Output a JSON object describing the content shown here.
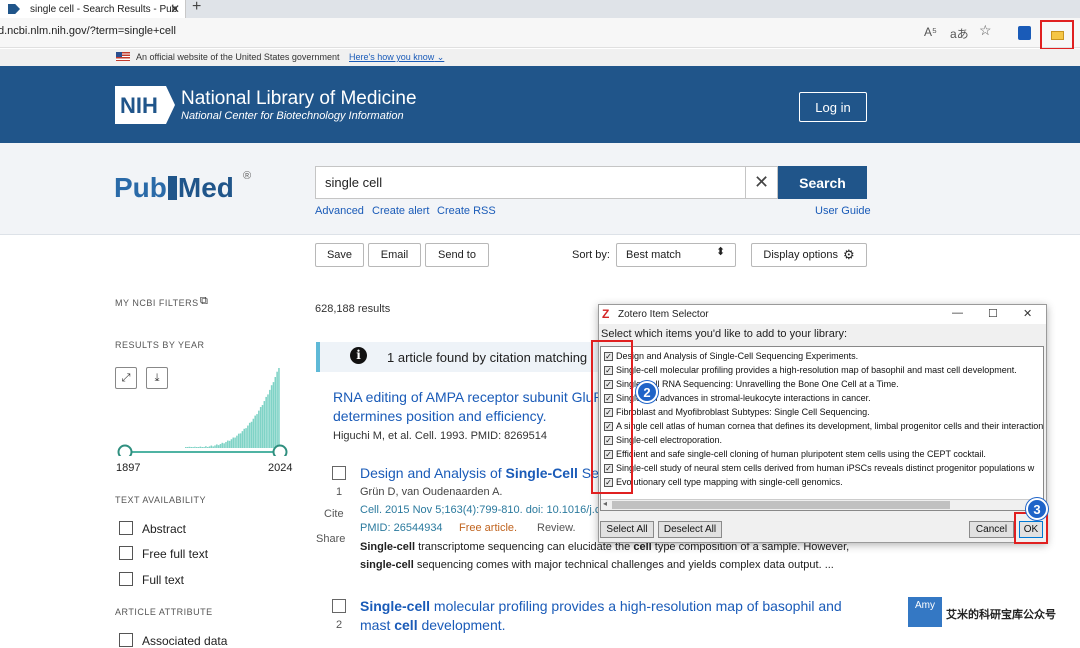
{
  "browser": {
    "tab_title": "single cell - Search Results - Pub",
    "tab_close": "✕",
    "new_tab": "+",
    "url": "d.ncbi.nlm.nih.gov/?term=single+cell",
    "icons": [
      "read-aloud-icon",
      "translate-icon",
      "favorite-icon",
      "bitwarden-icon",
      "zotero-save-icon"
    ],
    "read_aloud": "A⁵",
    "translate": "aあ",
    "favorite": "☆",
    "bitwarden": "⛉"
  },
  "gov_banner": {
    "text": "An official website of the United States government",
    "link": "Here's how you know"
  },
  "nih": {
    "logo": "NIH",
    "title": "National Library of Medicine",
    "subtitle": "National Center for Biotechnology Information",
    "login": "Log in"
  },
  "search": {
    "logo_pub": "Pub",
    "logo_med": "Med",
    "registered": "®",
    "value": "single cell",
    "clear": "✕",
    "button": "Search",
    "links": [
      "Advanced",
      "Create alert",
      "Create RSS"
    ],
    "user_guide": "User Guide"
  },
  "toolbar": {
    "save": "Save",
    "email": "Email",
    "send_to": "Send to",
    "sort_label": "Sort by:",
    "sort_value": "Best match",
    "display_options": "Display options"
  },
  "sidebar": {
    "my_filters": "MY NCBI FILTERS",
    "results_by_year": "RESULTS BY YEAR",
    "year_start": "1897",
    "year_end": "2024",
    "text_availability": "TEXT AVAILABILITY",
    "filters": [
      "Abstract",
      "Free full text",
      "Full text"
    ],
    "article_attribute": "ARTICLE ATTRIBUTE",
    "attribute_item": "Associated data"
  },
  "results": {
    "count": "628,188 results",
    "citation_note": "1 article found by citation matching",
    "cited": {
      "title_l1": "RNA editing of AMPA receptor subunit GluR",
      "title_l2": "determines position and efficiency.",
      "meta": "Higuchi M, et al. Cell. 1993. PMID: 8269514"
    },
    "r1": {
      "num": "1",
      "cite": "Cite",
      "share": "Share",
      "title_pre": "Design and Analysis of ",
      "title_bold": "Single-Cell",
      "title_post": " Seq",
      "authors": "Grün D, van Oudenaarden A.",
      "journal": "Cell. 2015 Nov 5;163(4):799-810. doi: 10.1016/j.cell",
      "pmid": "PMID: 26544934",
      "free": "Free article.",
      "review": "Review.",
      "snip1_b": "Single-cell",
      "snip1": " transcriptome sequencing can elucidate the ",
      "snip1_b2": "cell",
      "snip1_end": " type composition of a sample. However,",
      "snip2_b": "single-cell",
      "snip2": " sequencing comes with major technical challenges and yields complex data output. ..."
    },
    "r2": {
      "num": "2",
      "title_b1": "Single-cell",
      "title_mid": " molecular profiling provides a high-resolution map of basophil and",
      "title_l2_pre": "mast ",
      "title_l2_b": "cell",
      "title_l2_post": " development."
    }
  },
  "zotero": {
    "title": "Zotero Item Selector",
    "z": "Z",
    "minimize": "—",
    "maximize": "☐",
    "close": "✕",
    "prompt": "Select which items you'd like to add to your library:",
    "check": "✓",
    "items": [
      "Design and Analysis of Single-Cell Sequencing Experiments.",
      "Single-cell molecular profiling provides a high-resolution map of basophil and mast cell development.",
      "Single-Cell RNA Sequencing: Unravelling the Bone One Cell at a Time.",
      "Single-cell advances in stromal-leukocyte interactions in cancer.",
      "Fibroblast and Myofibroblast Subtypes: Single Cell Sequencing.",
      "A single cell atlas of human cornea that defines its development, limbal progenitor cells and their interactions",
      "Single-cell electroporation.",
      "Efficient and safe single-cell cloning of human pluripotent stem cells using the CEPT cocktail.",
      "Single-cell study of neural stem cells derived from human iPSCs reveals distinct progenitor populations w",
      "Evolutionary cell type mapping with single-cell genomics."
    ],
    "select_all": "Select All",
    "deselect_all": "Deselect All",
    "cancel": "Cancel",
    "ok": "OK"
  },
  "annotations": [
    "1",
    "2",
    "3"
  ],
  "watermark": {
    "logo": "Amy",
    "text": "艾米的科研宝库公众号"
  },
  "colors": {
    "nih_blue": "#20558a",
    "link_blue": "#1a5bb8",
    "histogram_teal": "#7fd3c6",
    "highlight_red": "#e02020",
    "badge_blue": "#1f64c8"
  }
}
